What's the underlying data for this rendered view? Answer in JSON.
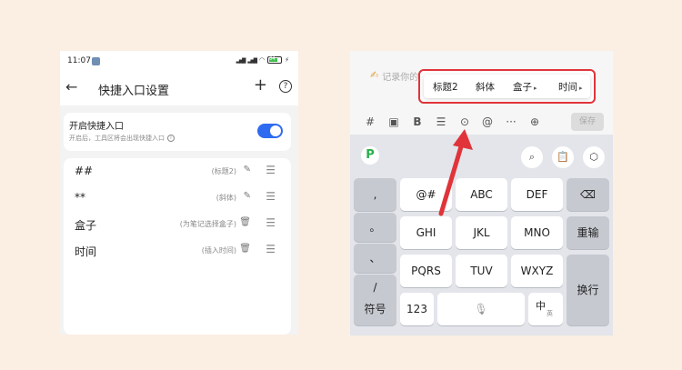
{
  "left_phone": {
    "status_time": "11:07",
    "battery": "84",
    "title": "快捷入口设置",
    "toggle": {
      "title": "开启快捷入口",
      "subtitle": "开启后，工具区将会出现快捷入口",
      "on": true,
      "color": "#2e6bf0"
    },
    "rows": [
      {
        "name": "##",
        "hint": "(标题2)",
        "action_icon": "edit-icon",
        "action": "✎"
      },
      {
        "name": "**",
        "hint": "(斜体)",
        "action_icon": "edit-icon",
        "action": "✎"
      },
      {
        "name": "盒子",
        "hint": "(为笔记选择盒子)",
        "action_icon": "trash-icon",
        "action": "🗑"
      },
      {
        "name": "时间",
        "hint": "(插入时间)",
        "action_icon": "trash-icon",
        "action": "🗑"
      }
    ]
  },
  "right_phone": {
    "placeholder": "记录你的想法",
    "popup_items": [
      {
        "label": "标题2",
        "has_arrow": false
      },
      {
        "label": "斜体",
        "has_arrow": false
      },
      {
        "label": "盒子",
        "has_arrow": true
      },
      {
        "label": "时间",
        "has_arrow": true
      }
    ],
    "save_label": "保存",
    "highlight_color": "#e0343a",
    "keys": {
      "punct": [
        ",",
        "。",
        "、",
        "/"
      ],
      "row1": [
        "@#",
        "ABC",
        "DEF"
      ],
      "row2": [
        "GHI",
        "JKL",
        "MNO"
      ],
      "row3": [
        "PQRS",
        "TUV",
        "WXYZ"
      ],
      "backspace": "⌫",
      "reenter": "重输",
      "newline": "换行",
      "symbols": "符号",
      "numbers": "123",
      "lang": "中",
      "lang_sub": "英"
    }
  }
}
